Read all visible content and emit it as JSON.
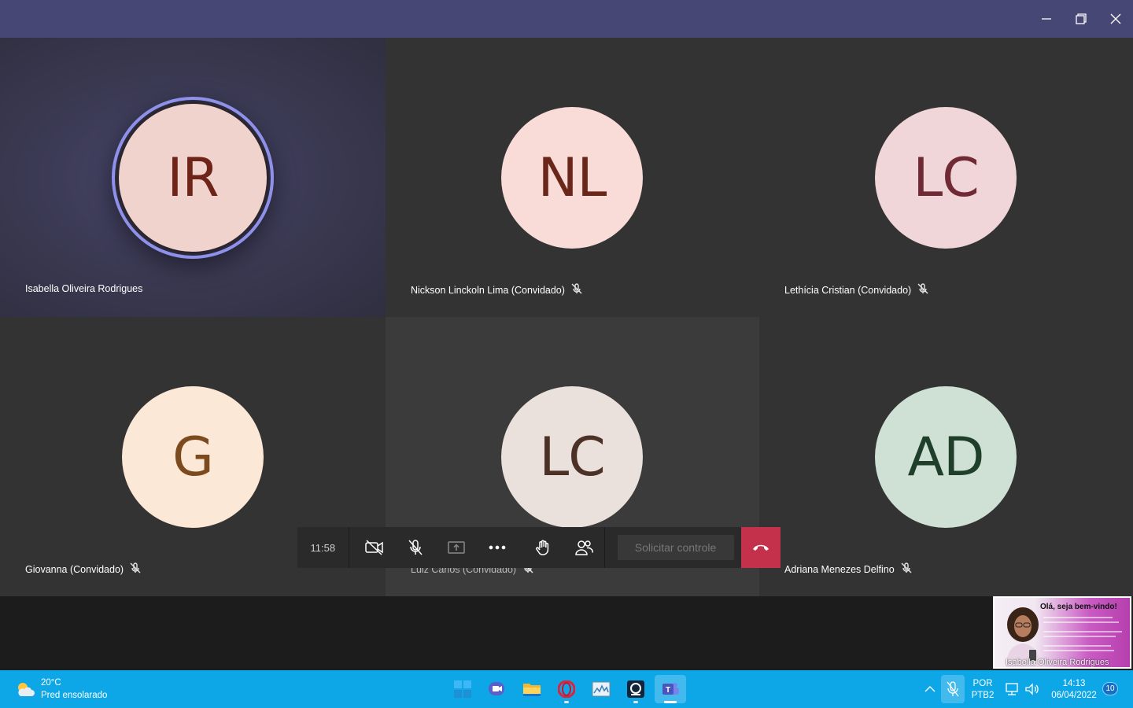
{
  "window": {
    "controls": [
      "minimize-icon",
      "restore-icon",
      "close-icon"
    ]
  },
  "participants": [
    {
      "initials": "IR",
      "name": "Isabella Oliveira Rodrigues",
      "muted": false,
      "speaking": true,
      "avatar_bg": "#f0d3cd",
      "avatar_fg": "#6e2418"
    },
    {
      "initials": "NL",
      "name": "Nickson Linckoln Lima (Convidado)",
      "muted": true,
      "avatar_bg": "#f9dcd8",
      "avatar_fg": "#6a2719"
    },
    {
      "initials": "LC",
      "name": "Lethícia Cristian (Convidado)",
      "muted": true,
      "avatar_bg": "#f1d6d9",
      "avatar_fg": "#702a36"
    },
    {
      "initials": "G",
      "name": "Giovanna (Convidado)",
      "muted": true,
      "avatar_bg": "#fbe8d6",
      "avatar_fg": "#7b4a1e"
    },
    {
      "initials": "LC",
      "name": "Luiz Carlos (Convidado)",
      "muted": true,
      "avatar_bg": "#eae0dc",
      "avatar_fg": "#4c3126"
    },
    {
      "initials": "AD",
      "name": "Adriana Menezes Delfino",
      "muted": true,
      "avatar_bg": "#cfe0d5",
      "avatar_fg": "#1f3f2a"
    }
  ],
  "callbar": {
    "timer": "11:58",
    "buttons": [
      "video-off-icon",
      "mic-off-icon",
      "share-screen-icon",
      "more-icon",
      "raise-hand-icon",
      "people-icon"
    ],
    "request_control_label": "Solicitar controle",
    "hangup_icon": "hang-up-icon"
  },
  "selfview": {
    "title": "Olá, seja bem-vindo!",
    "name": "Isabella Oliveira Rodrigues"
  },
  "taskbar": {
    "weather_temp": "20°C",
    "weather_desc": "Pred ensolarado",
    "apps": [
      "windows-start-icon",
      "teams-chat-icon",
      "file-explorer-icon",
      "opera-icon",
      "task-manager-icon",
      "app-icon",
      "teams-icon"
    ],
    "lang_top": "POR",
    "lang_bottom": "PTB2",
    "time": "14:13",
    "date": "06/04/2022",
    "notifications": "10"
  },
  "colors": {
    "titlebar": "#464775",
    "hangup": "#c4314b",
    "taskbar": "#0da7e8",
    "speaking_ring": "#8f90ea"
  }
}
